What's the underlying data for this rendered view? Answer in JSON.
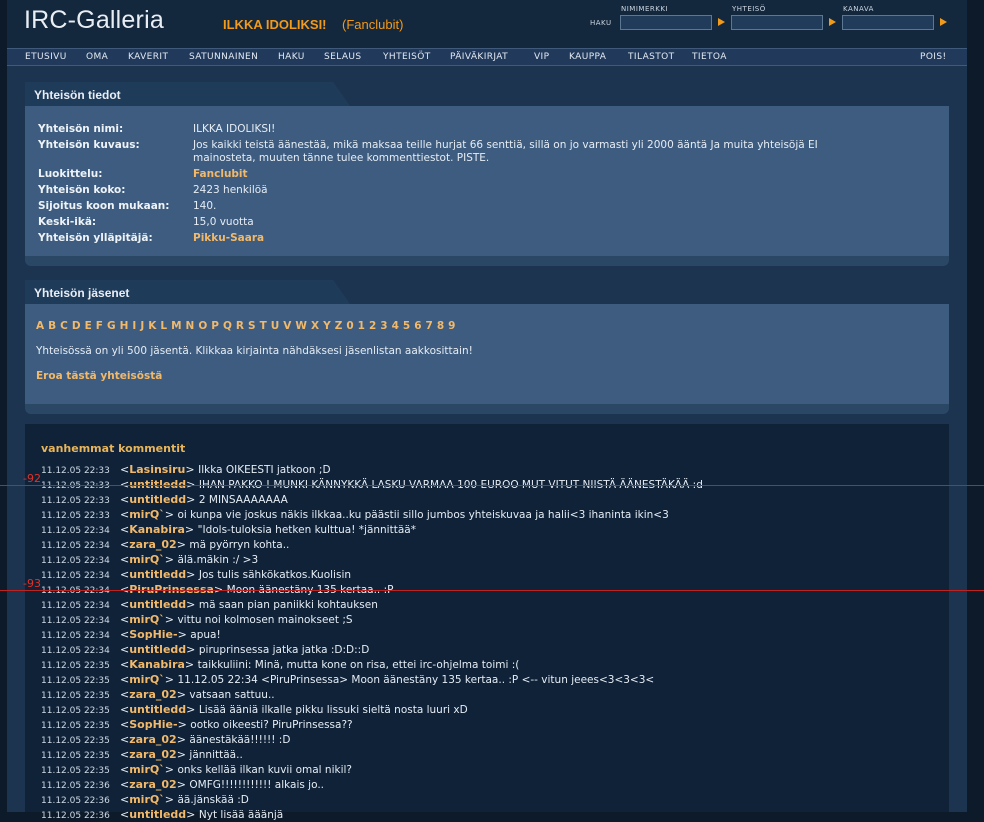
{
  "header": {
    "logo": "IRC-Galleria",
    "community_title": "ILKKA IDOLIKSI!",
    "community_category": "(Fanclubit)",
    "search_label": "HAKU",
    "fields": [
      {
        "label": "NIMIMERKKI"
      },
      {
        "label": "YHTEISÖ"
      },
      {
        "label": "KANAVA"
      }
    ]
  },
  "nav": {
    "items": [
      "ETUSIVU",
      "OMA",
      "KAVERIT",
      "SATUNNAINEN",
      "HAKU",
      "SELAUS",
      "YHTEISÖT",
      "PÄIVÄKIRJAT",
      "VIP",
      "KAUPPA",
      "TILASTOT",
      "TIETOA"
    ],
    "logout": "POIS!"
  },
  "info_panel": {
    "title": "Yhteisön tiedot",
    "rows": [
      {
        "label": "Yhteisön nimi:",
        "value": "ILKKA IDOLIKSI!"
      },
      {
        "label": "Yhteisön kuvaus:",
        "value": "Jos kaikki teistä äänestää, mikä maksaa teille hurjat 66 senttiä, sillä on jo varmasti yli 2000 ääntä Ja muita yhteisöjä EI",
        "value2": "mainosteta, muuten tänne tulee kommenttiestot. PISTE."
      },
      {
        "label": "Luokittelu:",
        "value": "Fanclubit"
      },
      {
        "label": "Yhteisön koko:",
        "value": "2423 henkilöä"
      },
      {
        "label": "Sijoitus koon mukaan:",
        "value": "140."
      },
      {
        "label": "Keski-ikä:",
        "value": "15,0 vuotta"
      },
      {
        "label": "Yhteisön ylläpitäjä:",
        "value": "Pikku-Saara"
      }
    ]
  },
  "members_panel": {
    "title": "Yhteisön jäsenet",
    "letters": [
      "A",
      "B",
      "C",
      "D",
      "E",
      "F",
      "G",
      "H",
      "I",
      "J",
      "K",
      "L",
      "M",
      "N",
      "O",
      "P",
      "Q",
      "R",
      "S",
      "T",
      "U",
      "V",
      "W",
      "X",
      "Y",
      "Z",
      "0",
      "1",
      "2",
      "3",
      "4",
      "5",
      "6",
      "7",
      "8",
      "9"
    ],
    "info": "Yhteisössä on yli 500 jäsentä. Klikkaa kirjainta nähdäksesi jäsenlistan aakkosittain!",
    "leave": "Eroa tästä yhteisöstä"
  },
  "comments": {
    "older": "vanhemmat kommentit",
    "markers": [
      {
        "label": "-92"
      },
      {
        "label": "-93"
      }
    ],
    "rows": [
      {
        "time": "11.12.05 22:33",
        "nick": "Lasinsiru",
        "text": "Ilkka OIKEESTI jatkoon ;D"
      },
      {
        "time": "11.12.05 22:33",
        "nick": "untitledd",
        "text": "IHAN PAKKO ! MUNKI KÄNNYKKÄ LASKU VARMAA 100 EUROO MUT VITUT NIISTÄ ÄÄNESTÄKÄÄ :d"
      },
      {
        "time": "11.12.05 22:33",
        "nick": "untitledd",
        "text": "2 MINSAAAAAAA"
      },
      {
        "time": "11.12.05 22:33",
        "nick": "mirQ`",
        "text": "oi kunpa vie joskus näkis ilkkaa..ku päästii sillo jumbos yhteiskuvaa ja halii<3 ihaninta ikin<3"
      },
      {
        "time": "11.12.05 22:34",
        "nick": "Kanabira",
        "text": "\"Idols-tuloksia hetken kulttua! *jännittää*"
      },
      {
        "time": "11.12.05 22:34",
        "nick": "zara_02",
        "text": "mä pyörryn kohta.."
      },
      {
        "time": "11.12.05 22:34",
        "nick": "mirQ`",
        "text": "älä.mäkin :/ >3"
      },
      {
        "time": "11.12.05 22:34",
        "nick": "untitledd",
        "text": "Jos tulis sähkökatkos.Kuolisin"
      },
      {
        "time": "11.12.05 22:34",
        "nick": "PiruPrinsessa",
        "text": "Moon äänestäny 135 kertaa.. :P"
      },
      {
        "time": "11.12.05 22:34",
        "nick": "untitledd",
        "text": "mä saan pian paniikki kohtauksen"
      },
      {
        "time": "11.12.05 22:34",
        "nick": "mirQ`",
        "text": "vittu noi kolmosen mainokseet ;S"
      },
      {
        "time": "11.12.05 22:34",
        "nick": "SopHie-",
        "text": "apua!"
      },
      {
        "time": "11.12.05 22:34",
        "nick": "untitledd",
        "text": "piruprinsessa jatka jatka :D:D::D"
      },
      {
        "time": "11.12.05 22:35",
        "nick": "Kanabira",
        "text": "taikkuliini: Minä, mutta kone on risa, ettei irc-ohjelma toimi :("
      },
      {
        "time": "11.12.05 22:35",
        "nick": "mirQ`",
        "text": "11.12.05 22:34 <PiruPrinsessa> Moon äänestäny 135 kertaa.. :P <-- vitun jeees<3<3<3<"
      },
      {
        "time": "11.12.05 22:35",
        "nick": "zara_02",
        "text": "vatsaan sattuu.."
      },
      {
        "time": "11.12.05 22:35",
        "nick": "untitledd",
        "text": "Lisää ääniä ilkalle pikku lissuki sieltä nosta luuri xD"
      },
      {
        "time": "11.12.05 22:35",
        "nick": "SopHie-",
        "text": "ootko oikeesti? PiruPrinsessa??"
      },
      {
        "time": "11.12.05 22:35",
        "nick": "zara_02",
        "text": "äänestäkää!!!!!! :D"
      },
      {
        "time": "11.12.05 22:35",
        "nick": "zara_02",
        "text": "jännittää.."
      },
      {
        "time": "11.12.05 22:35",
        "nick": "mirQ`",
        "text": "onks kellää ilkan kuvii omal nikil?"
      },
      {
        "time": "11.12.05 22:36",
        "nick": "zara_02",
        "text": "OMFG!!!!!!!!!!!! alkais jo.."
      },
      {
        "time": "11.12.05 22:36",
        "nick": "mirQ`",
        "text": "ää.jänskää :D"
      },
      {
        "time": "11.12.05 22:36",
        "nick": "untitledd",
        "text": "Nyt lisää ääänjä"
      }
    ]
  }
}
